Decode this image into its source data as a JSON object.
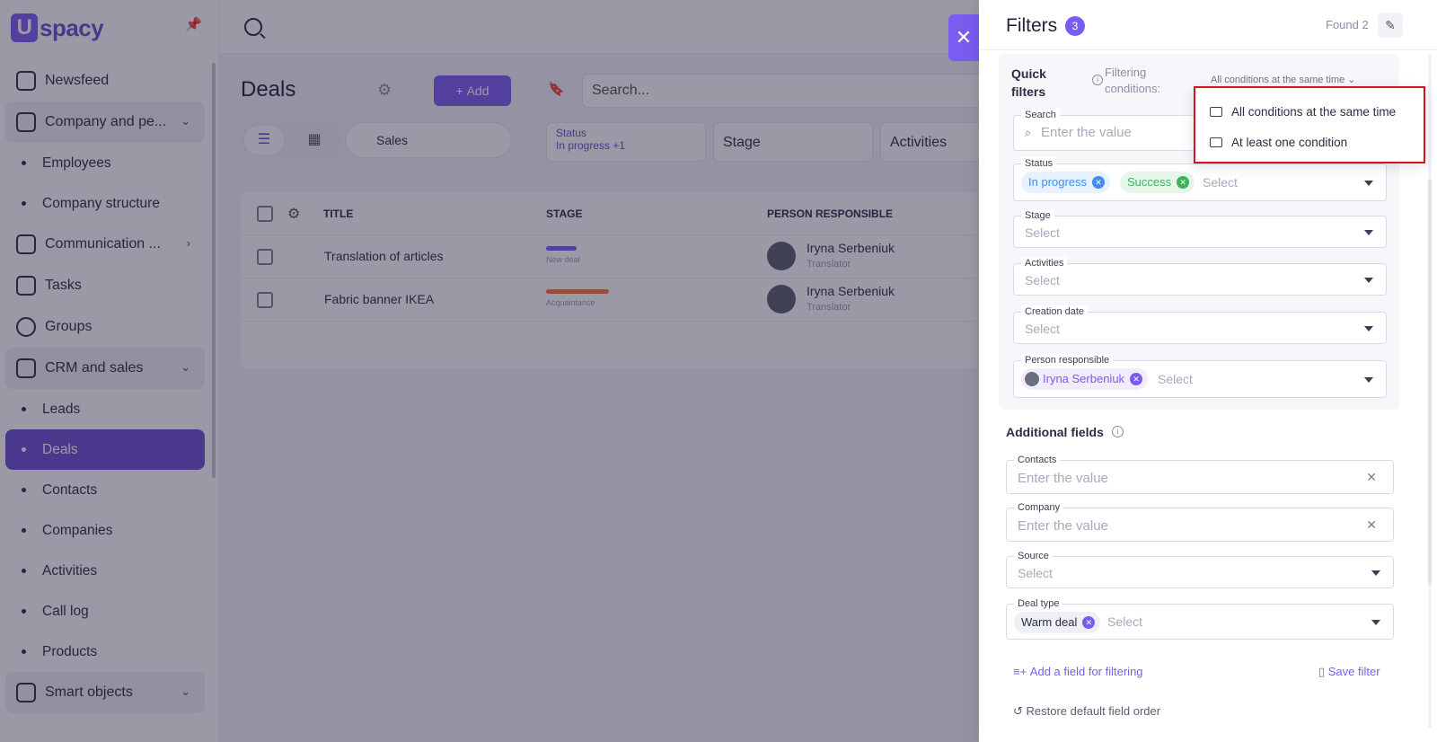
{
  "app": {
    "brand": "Uspacy"
  },
  "sidebar": {
    "items": [
      {
        "label": "Newsfeed"
      },
      {
        "label": "Company and pe..."
      },
      {
        "label": "Employees"
      },
      {
        "label": "Company structure"
      },
      {
        "label": "Communication ..."
      },
      {
        "label": "Tasks"
      },
      {
        "label": "Groups"
      },
      {
        "label": "CRM and sales"
      },
      {
        "label": "Leads"
      },
      {
        "label": "Deals"
      },
      {
        "label": "Contacts"
      },
      {
        "label": "Companies"
      },
      {
        "label": "Activities"
      },
      {
        "label": "Call log"
      },
      {
        "label": "Products"
      },
      {
        "label": "Smart objects"
      }
    ]
  },
  "main": {
    "title": "Deals",
    "add_label": "Add",
    "search_placeholder": "Search...",
    "pipeline": "Sales",
    "filter_status_label": "Status",
    "filter_status_value": "In progress +1",
    "filter_stage": "Stage",
    "filter_activities": "Activities",
    "columns": {
      "title": "TITLE",
      "stage": "STAGE",
      "person": "PERSON RESPONSIBLE"
    },
    "rows": [
      {
        "title": "Translation of articles",
        "stage": "New deal",
        "person": "Iryna Serbeniuk",
        "role": "Translator",
        "stage_color": "#7b5cf0"
      },
      {
        "title": "Fabric banner IKEA",
        "stage": "Acquaintance",
        "person": "Iryna Serbeniuk",
        "role": "Translator",
        "stage_color": "#f07b3c"
      }
    ]
  },
  "drawer": {
    "title": "Filters",
    "count": "3",
    "found": "Found 2",
    "quick_filters_title": "Quick filters",
    "filtering_conditions_label": "Filtering conditions:",
    "filtering_conditions_value": "All conditions at the same time",
    "fields": {
      "search_label": "Search",
      "search_placeholder": "Enter the value",
      "status_label": "Status",
      "status_chips": [
        "In progress",
        "Success"
      ],
      "select_placeholder": "Select",
      "stage_label": "Stage",
      "activities_label": "Activities",
      "creation_date_label": "Creation date",
      "person_label": "Person responsible",
      "person_chip": "Iryna Serbeniuk"
    },
    "additional_title": "Additional fields",
    "additional": {
      "contacts_label": "Contacts",
      "company_label": "Company",
      "source_label": "Source",
      "deal_type_label": "Deal type",
      "deal_type_chip": "Warm deal",
      "enter_value": "Enter the value"
    },
    "add_field_label": "Add a field for filtering",
    "save_filter_label": "Save filter",
    "restore_label": "Restore default field order"
  },
  "popup": {
    "options": [
      "All conditions at the same time",
      "At least one condition"
    ]
  },
  "colors": {
    "accent": "#7b5cf0",
    "status_in_progress": "#3d8ef0",
    "status_success": "#3bb35c",
    "highlight_border": "#d7141a"
  }
}
